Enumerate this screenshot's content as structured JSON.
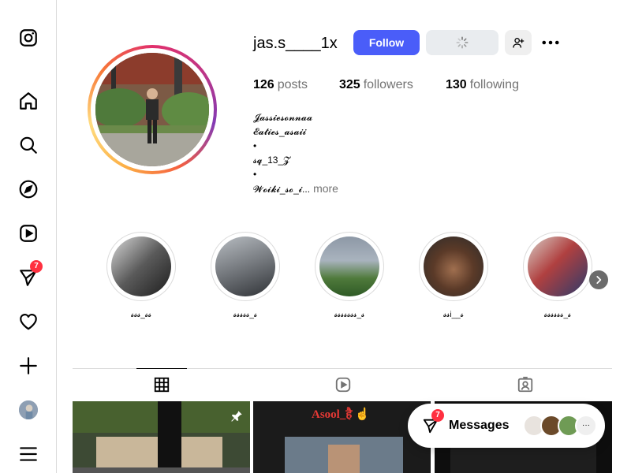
{
  "nav": {
    "items": [
      {
        "name": "instagram-logo"
      },
      {
        "name": "home"
      },
      {
        "name": "search"
      },
      {
        "name": "explore"
      },
      {
        "name": "reels"
      },
      {
        "name": "messages",
        "badge": "7"
      },
      {
        "name": "notifications"
      },
      {
        "name": "create"
      },
      {
        "name": "profile"
      },
      {
        "name": "more"
      }
    ]
  },
  "profile": {
    "username": "jas.s____1x",
    "follow_label": "Follow",
    "stats": {
      "posts_count": "126",
      "posts_label": "posts",
      "followers_count": "325",
      "followers_label": "followers",
      "following_count": "130",
      "following_label": "following"
    },
    "bio": {
      "line1": "𝓙𝓪𝓼𝓼𝓲𝓮𝓼𝓸𝓷𝓷𝓪𝓪",
      "line2": "𝓔𝓪𝓽𝓲𝓮𝓼_𝓪𝓼𝓪𝓲𝓲",
      "line3": "•",
      "line4": "𝓼𝓺_13_𝓩",
      "line5": "•",
      "line6": "𝓦𝓸𝓲𝓴𝓲_𝓼𝓸_𝓲...",
      "more_label": "more"
    }
  },
  "highlights": [
    {
      "label": "𝓼𝓼𝓼_𝓼𝓼"
    },
    {
      "label": "𝓼𝓼𝓼𝓼𝓼_𝓼"
    },
    {
      "label": "𝓼𝓼𝓼𝓼𝓼𝓼𝓼_𝓼"
    },
    {
      "label": "𝓼𝓼i__𝓼"
    },
    {
      "label": "𝓼𝓼𝓼𝓼𝓼𝓼_𝓼"
    }
  ],
  "posts": [
    {
      "caption": ""
    },
    {
      "caption": "Asool_है ☝"
    },
    {
      "caption": ""
    }
  ],
  "messages_pill": {
    "label": "Messages",
    "badge": "7",
    "more": "···"
  },
  "colors": {
    "follow_blue": "#4a5df9",
    "badge_red": "#ff3040",
    "muted_text": "#737373",
    "border": "#dbdbdb"
  }
}
